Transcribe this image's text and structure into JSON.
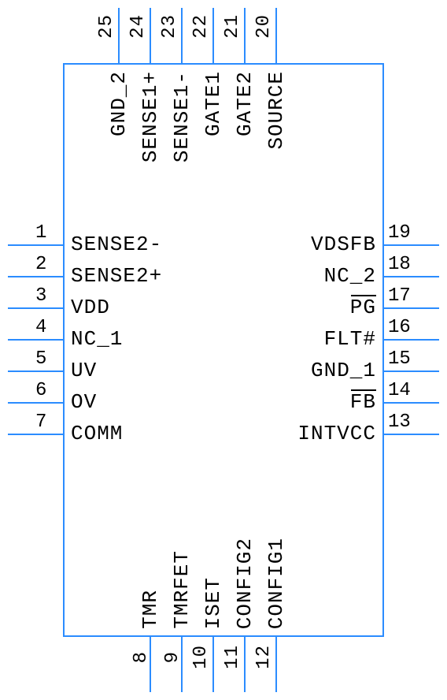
{
  "left_pins": [
    {
      "num": "1",
      "label": "SENSE2-"
    },
    {
      "num": "2",
      "label": "SENSE2+"
    },
    {
      "num": "3",
      "label": "VDD"
    },
    {
      "num": "4",
      "label": "NC_1"
    },
    {
      "num": "5",
      "label": "UV"
    },
    {
      "num": "6",
      "label": "OV"
    },
    {
      "num": "7",
      "label": "COMM"
    }
  ],
  "right_pins": [
    {
      "num": "19",
      "label": "VDSFB"
    },
    {
      "num": "18",
      "label": "NC_2"
    },
    {
      "num": "17",
      "label": "PG"
    },
    {
      "num": "16",
      "label": "FLT#"
    },
    {
      "num": "15",
      "label": "GND_1"
    },
    {
      "num": "14",
      "label": "FB"
    },
    {
      "num": "13",
      "label": "INTVCC"
    }
  ],
  "top_pins": [
    {
      "num": "25",
      "label": "GND_2"
    },
    {
      "num": "24",
      "label": "SENSE1+"
    },
    {
      "num": "23",
      "label": "SENSE1-"
    },
    {
      "num": "22",
      "label": "GATE1"
    },
    {
      "num": "21",
      "label": "GATE2"
    },
    {
      "num": "20",
      "label": "SOURCE"
    }
  ],
  "bottom_pins": [
    {
      "num": "8",
      "label": "TMR"
    },
    {
      "num": "9",
      "label": "TMRFET"
    },
    {
      "num": "10",
      "label": "ISET"
    },
    {
      "num": "11",
      "label": "CONFIG2"
    },
    {
      "num": "12",
      "label": "CONFIG1"
    }
  ]
}
